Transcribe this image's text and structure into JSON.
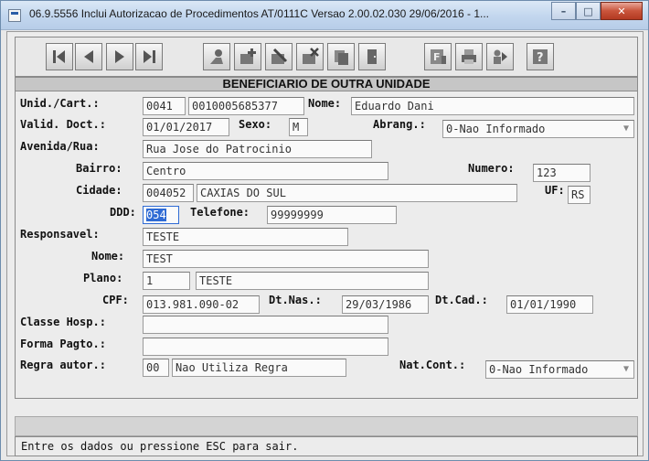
{
  "window": {
    "title": "06.9.5556   Inclui  Autorizacao de Procedimentos AT/0111C Versao 2.00.02.030 29/06/2016 - 1...",
    "minimize": "–",
    "maximize": "□",
    "close": "✕"
  },
  "toolbar": {
    "buttons": [
      "first-record",
      "previous-record",
      "next-record",
      "last-record",
      "search",
      "add",
      "edit",
      "delete",
      "copy",
      "exit-door",
      "filter",
      "print",
      "help-agent",
      "help"
    ]
  },
  "section_title": "BENEFICIARIO DE OUTRA UNIDADE",
  "form": {
    "unid_cart": {
      "label": "Unid./Cart.:",
      "unid": "0041",
      "cart": "0010005685377"
    },
    "nome_benef": {
      "label": "Nome:",
      "value": "Eduardo Dani"
    },
    "valid_doct": {
      "label": "Valid. Doct.:",
      "value": "01/01/2017"
    },
    "sexo": {
      "label": "Sexo:",
      "value": "M"
    },
    "abrang": {
      "label": "Abrang.:",
      "value": "0-Nao Informado"
    },
    "avenida": {
      "label": "Avenida/Rua:",
      "value": "Rua Jose do Patrocinio"
    },
    "bairro": {
      "label": "Bairro:",
      "value": "Centro"
    },
    "numero": {
      "label": "Numero:",
      "value": "123"
    },
    "cidade": {
      "label": "Cidade:",
      "code": "004052",
      "name": "CAXIAS DO SUL"
    },
    "uf": {
      "label": "UF:",
      "value": "RS"
    },
    "ddd": {
      "label": "DDD:",
      "value": "054"
    },
    "telefone": {
      "label": "Telefone:",
      "value": "99999999"
    },
    "responsavel": {
      "label": "Responsavel:",
      "value": "TESTE"
    },
    "nome": {
      "label": "Nome:",
      "value": "TEST"
    },
    "plano": {
      "label": "Plano:",
      "code": "1",
      "name": "TESTE"
    },
    "cpf": {
      "label": "CPF:",
      "value": "013.981.090-02"
    },
    "dt_nas": {
      "label": "Dt.Nas.:",
      "value": "29/03/1986"
    },
    "dt_cad": {
      "label": "Dt.Cad.:",
      "value": "01/01/1990"
    },
    "classe_hosp": {
      "label": "Classe Hosp.:",
      "value": ""
    },
    "forma_pagto": {
      "label": "Forma Pagto.:",
      "value": ""
    },
    "regra_autor": {
      "label": "Regra autor.:",
      "code": "00",
      "name": "Nao Utiliza Regra"
    },
    "nat_cont": {
      "label": "Nat.Cont.:",
      "value": "0-Nao Informado"
    }
  },
  "status": "Entre os dados ou pressione ESC para sair."
}
